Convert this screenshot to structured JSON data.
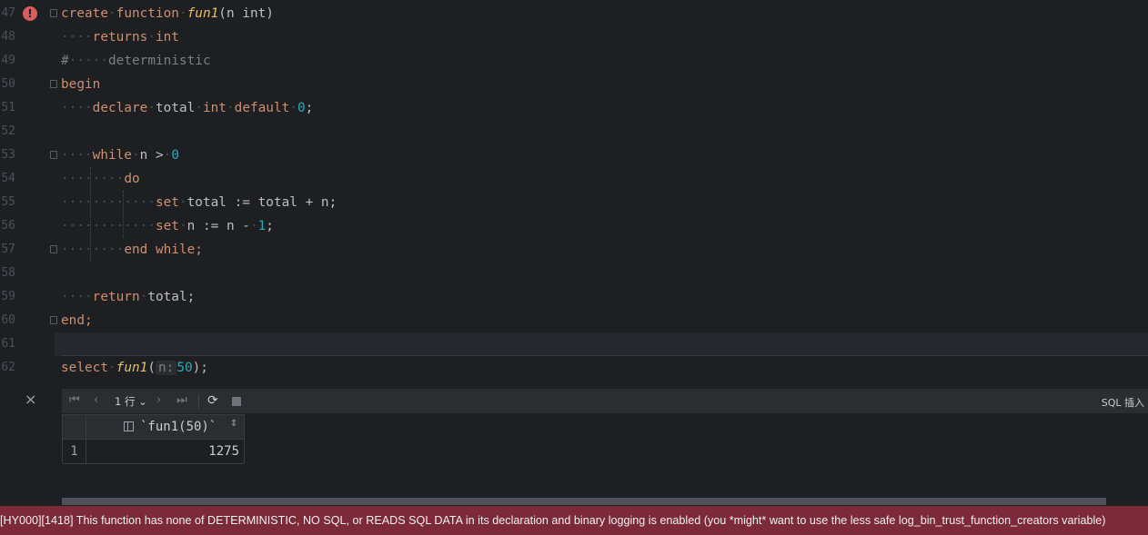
{
  "editor": {
    "line_numbers": [
      "47",
      "48",
      "49",
      "50",
      "51",
      "52",
      "53",
      "54",
      "55",
      "56",
      "57",
      "58",
      "59",
      "60",
      "61",
      "62"
    ],
    "tokens": {
      "create": "create",
      "function": "function",
      "fun1": "fun1",
      "params": "(n int)",
      "returns": "returns",
      "int": "int",
      "comment_hash": "#",
      "deterministic": "deterministic",
      "begin": "begin",
      "declare": "declare",
      "total": "total",
      "int2": "int",
      "default": "default",
      "zero": "0",
      "semi": ";",
      "while": "while",
      "n_gt": "n >",
      "zero2": "0",
      "do": "do",
      "set1": "set",
      "set1_expr": "total := total + n;",
      "set2": "set",
      "set2_expr": "n := n -",
      "one": "1",
      "semi2": ";",
      "end_while": "end while;",
      "return": "return",
      "return_expr": "total;",
      "end": "end;",
      "select": "select",
      "fun1_call": "fun1",
      "open_paren": "(",
      "hint_n": "n:",
      "fifty": "50",
      "close": ");"
    },
    "error_marker": "!"
  },
  "results": {
    "close_icon": "×",
    "toolbar": {
      "first_icon": "|<",
      "prev_icon": "<",
      "rows_label": "1 行",
      "next_icon": ">",
      "last_icon": ">|",
      "mode_label": "SQL 插入"
    },
    "table": {
      "column_header": "`fun1(50)`",
      "rows": [
        {
          "num": "1",
          "value": "1275"
        }
      ]
    }
  },
  "error_message": "[HY000][1418] This function has none of DETERMINISTIC, NO SQL, or READS SQL DATA in its declaration and binary logging is enabled (you *might* want to use the less safe log_bin_trust_function_creators variable)",
  "colors": {
    "background": "#1e1f22",
    "keyword": "#cf8e6d",
    "function": "#e8bc6b",
    "number": "#2aacb8",
    "error_bar": "#7c2a39",
    "error_icon": "#db5c5c"
  }
}
